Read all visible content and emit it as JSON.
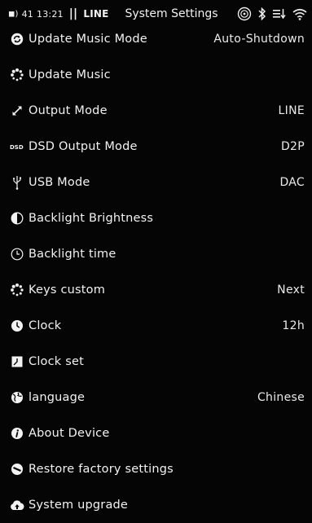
{
  "status_bar": {
    "volume": "41",
    "time": "13:21",
    "output": "LINE",
    "title": "System Settings"
  },
  "menu": [
    {
      "id": "update-music-mode",
      "label": "Update Music Mode",
      "value": "Auto-Shutdown",
      "icon": "refresh-icon"
    },
    {
      "id": "update-music",
      "label": "Update Music",
      "value": "",
      "icon": "spinner-icon"
    },
    {
      "id": "output-mode",
      "label": "Output Mode",
      "value": "LINE",
      "icon": "expand-arrows-icon"
    },
    {
      "id": "dsd-output-mode",
      "label": "DSD Output Mode",
      "value": "D2P",
      "icon": "dsd-icon"
    },
    {
      "id": "usb-mode",
      "label": "USB Mode",
      "value": "DAC",
      "icon": "usb-icon"
    },
    {
      "id": "backlight-brightness",
      "label": "Backlight Brightness",
      "value": "",
      "icon": "contrast-icon"
    },
    {
      "id": "backlight-time",
      "label": "Backlight time",
      "value": "",
      "icon": "clock-outline-icon"
    },
    {
      "id": "keys-custom",
      "label": "Keys custom",
      "value": "Next",
      "icon": "spinner-icon"
    },
    {
      "id": "clock",
      "label": "Clock",
      "value": "12h",
      "icon": "clock-filled-icon"
    },
    {
      "id": "clock-set",
      "label": "Clock set",
      "value": "",
      "icon": "clock-set-icon"
    },
    {
      "id": "language",
      "label": "language",
      "value": "Chinese",
      "icon": "globe-icon"
    },
    {
      "id": "about-device",
      "label": "About Device",
      "value": "",
      "icon": "info-icon"
    },
    {
      "id": "restore-factory-settings",
      "label": "Restore factory settings",
      "value": "",
      "icon": "restore-icon"
    },
    {
      "id": "system-upgrade",
      "label": "System upgrade",
      "value": "",
      "icon": "upgrade-icon"
    }
  ]
}
